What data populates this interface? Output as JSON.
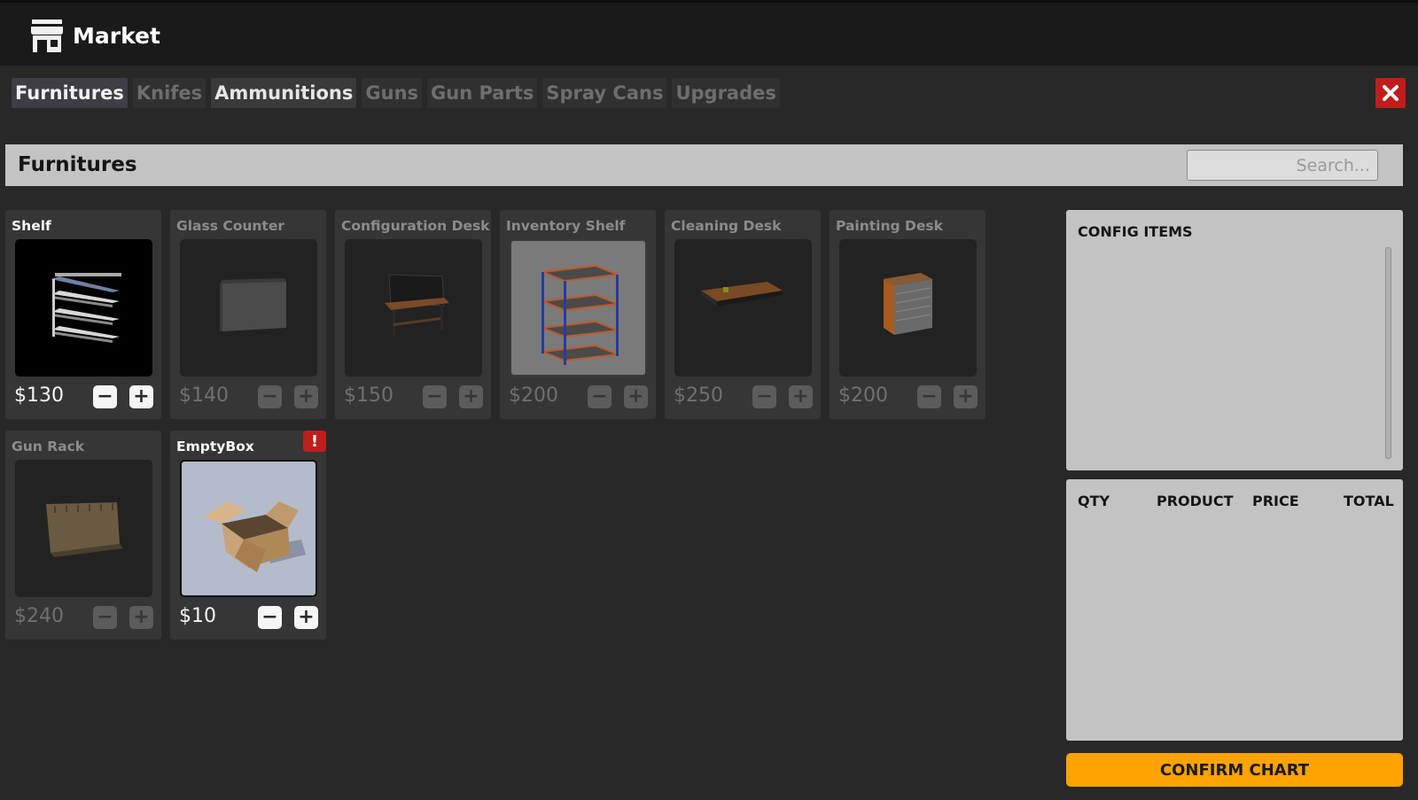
{
  "app": {
    "title": "Market",
    "icon": "store-icon"
  },
  "tabs": [
    {
      "label": "Furnitures",
      "state": "active"
    },
    {
      "label": "Knifes",
      "state": "inactive"
    },
    {
      "label": "Ammunitions",
      "state": "highlighted"
    },
    {
      "label": "Guns",
      "state": "inactive"
    },
    {
      "label": "Gun Parts",
      "state": "inactive"
    },
    {
      "label": "Spray Cans",
      "state": "inactive"
    },
    {
      "label": "Upgrades",
      "state": "inactive"
    }
  ],
  "close_icon": "close-icon",
  "section": {
    "title": "Furnitures",
    "search_placeholder": "Search..."
  },
  "products": [
    {
      "name": "Shelf",
      "price": "$130",
      "enabled": true,
      "image": "wall-shelf"
    },
    {
      "name": "Glass Counter",
      "price": "$140",
      "enabled": false,
      "image": "glass-counter"
    },
    {
      "name": "Configuration Desk",
      "price": "$150",
      "enabled": false,
      "image": "configuration-desk"
    },
    {
      "name": "Inventory Shelf",
      "price": "$200",
      "enabled": false,
      "image": "inventory-shelf"
    },
    {
      "name": "Cleaning Desk",
      "price": "$250",
      "enabled": false,
      "image": "cleaning-desk"
    },
    {
      "name": "Painting Desk",
      "price": "$200",
      "enabled": false,
      "image": "painting-desk"
    },
    {
      "name": "Gun Rack",
      "price": "$240",
      "enabled": false,
      "image": "gun-rack"
    },
    {
      "name": "EmptyBox",
      "price": "$10",
      "enabled": true,
      "image": "cardboard-box",
      "badge": "!"
    }
  ],
  "config_items": {
    "title": "CONFIG ITEMS"
  },
  "cart": {
    "columns": [
      "QTY",
      "PRODUCT",
      "PRICE",
      "TOTAL"
    ]
  },
  "confirm_button": {
    "label": "CONFIRM CHART"
  },
  "colors": {
    "background": "#282828",
    "topbar": "#1a1a1a",
    "panel": "#c3c3c3",
    "accent": "#ffa300",
    "close": "#c01d1d"
  }
}
